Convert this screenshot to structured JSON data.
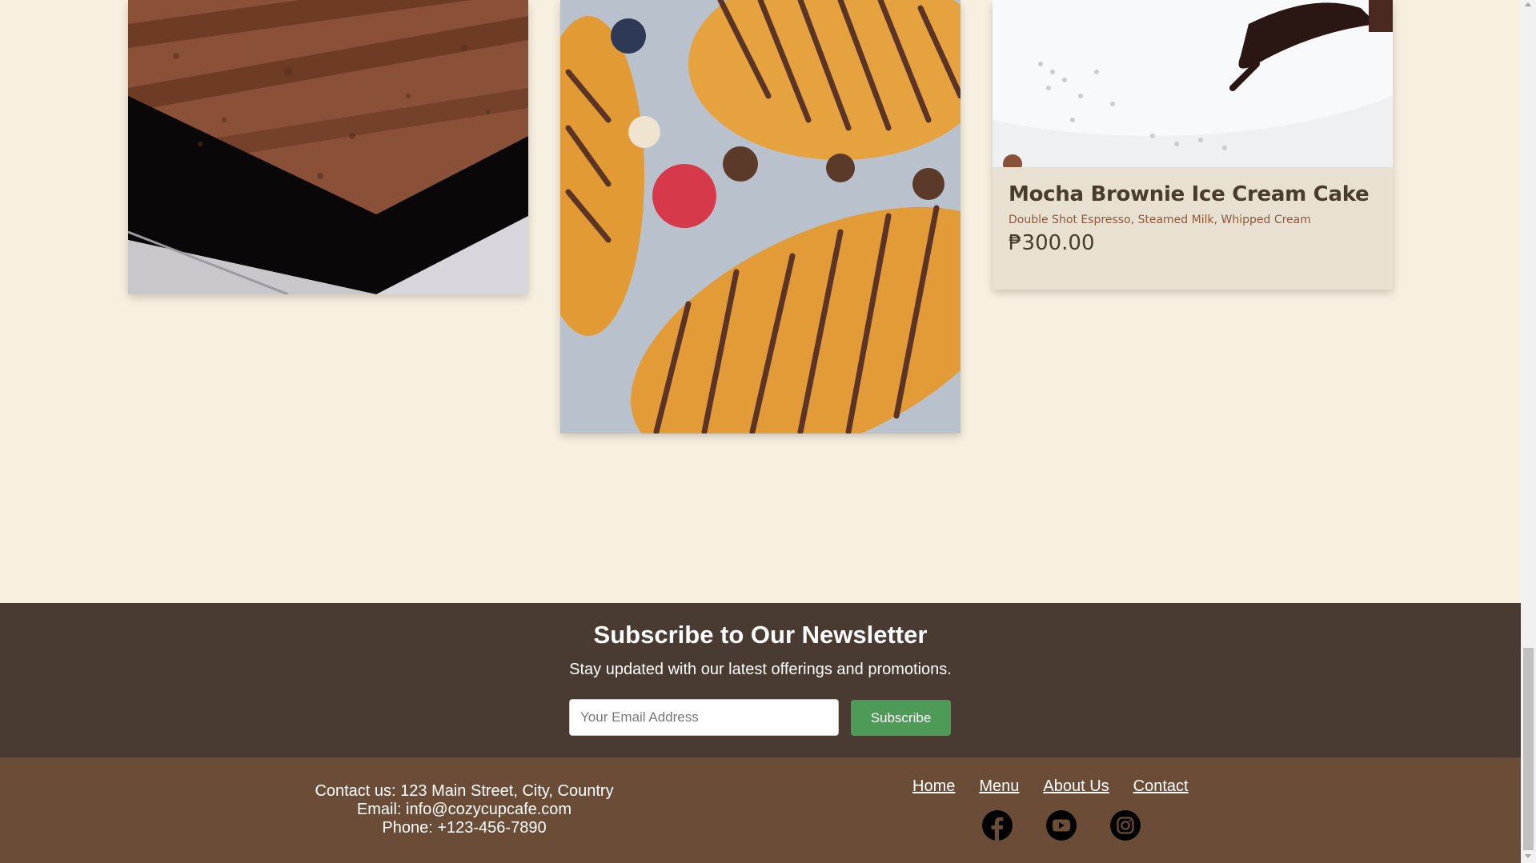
{
  "products": [
    {
      "image": "chocolate-layer-cake-image"
    },
    {
      "image": "chocolate-drizzled-croissants-image"
    },
    {
      "image": "mocha-brownie-plate-image",
      "name": "Mocha Brownie Ice Cream Cake",
      "description": "Double Shot Espresso, Steamed Milk, Whipped Cream",
      "price": "₱300.00"
    }
  ],
  "newsletter": {
    "title": "Subscribe to Our Newsletter",
    "subtitle": "Stay updated with our latest offerings and promotions.",
    "email_placeholder": "Your Email Address",
    "button_label": "Subscribe",
    "button_color": "#4e9a57",
    "background": "#4a3b32"
  },
  "footer": {
    "background": "#6b4c36",
    "contact_line": "Contact us: 123 Main Street, City, Country",
    "email_line": "Email: info@cozycupcafe.com",
    "phone_line": "Phone: +123-456-7890",
    "nav": [
      "Home",
      "Menu",
      "About Us",
      "Contact"
    ],
    "socials": [
      "facebook-icon",
      "youtube-icon",
      "instagram-icon"
    ]
  }
}
